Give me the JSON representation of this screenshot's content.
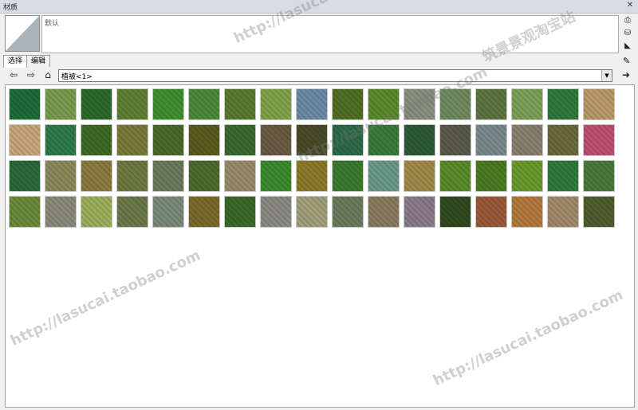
{
  "window": {
    "title": "材质",
    "close_glyph": "✕"
  },
  "preview": {
    "name_value": "默认"
  },
  "side_tools": [
    "⎙",
    "⛁",
    "◣"
  ],
  "tabs": [
    {
      "label": "选择",
      "active": true
    },
    {
      "label": "编辑",
      "active": false
    }
  ],
  "nav": {
    "back_glyph": "⇦",
    "forward_glyph": "⇨",
    "home_glyph": "⌂",
    "collection": "植被<1>",
    "dropdown_glyph": "▼",
    "details_glyph": "➜",
    "pipette_glyph": "✎"
  },
  "watermarks": [
    "http://lasucai.taobao.com",
    "筑景景观淘宝站"
  ],
  "swatches": [
    "#1f6b3a",
    "#7a9a4e",
    "#2c6a2a",
    "#5e7f32",
    "#3f8f2f",
    "#4c8a3a",
    "#5b7a2e",
    "#7fa24a",
    "#6b8aa6",
    "#4f6e22",
    "#5a8a2a",
    "#8a8f80",
    "#6f8a5e",
    "#5c7440",
    "#7aa05a",
    "#2f7a3a",
    "#b89a6a",
    "#c9a57a",
    "#2e7a4a",
    "#3e6a24",
    "#7a7a3a",
    "#4a6a2a",
    "#5c5a1e",
    "#3a6a2e",
    "#6a5a44",
    "#4a4a2a",
    "#2e6a4a",
    "#3a7a3a",
    "#2e5a3a",
    "#5a5a4a",
    "#7a8a8a",
    "#8a8070",
    "#6a6a3a",
    "#c05070",
    "#2a6a3a",
    "#8a8a5a",
    "#8a7a3e",
    "#6e7a40",
    "#6a7a5a",
    "#4e6a2e",
    "#9a8a6a",
    "#3a8a2e",
    "#8a7a2a",
    "#3a7a2e",
    "#6a9a8a",
    "#a08a4a",
    "#5a8a2a",
    "#4a7a22",
    "#6a9a2a",
    "#2e7a3a",
    "#4a7a3a",
    "#6a8a3a",
    "#8a8a7a",
    "#9ab05a",
    "#6a7a4a",
    "#7a8a7a",
    "#7a6a2a",
    "#3a6a2a",
    "#8a8a82",
    "#a0a07a",
    "#6a7a5a",
    "#8a7a60",
    "#8a7a8a",
    "#2e4a1e",
    "#9a5a3a",
    "#b07a3a",
    "#a08a6a",
    "#4e5e2e"
  ]
}
